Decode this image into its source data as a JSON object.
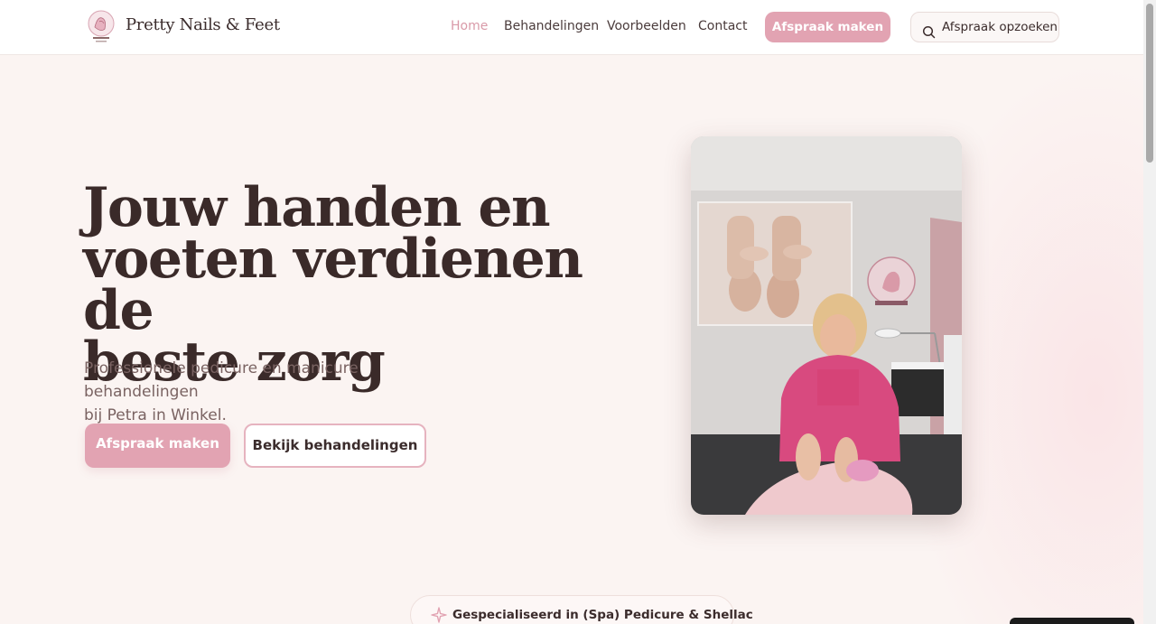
{
  "brand": {
    "name": "Pretty Nails & Feet"
  },
  "nav": {
    "items": [
      {
        "label": "Home",
        "active": true
      },
      {
        "label": "Behandelingen",
        "active": false
      },
      {
        "label": "Voorbeelden",
        "active": false
      },
      {
        "label": "Contact",
        "active": false
      }
    ],
    "cta_label": "Afspraak maken",
    "lookup_label": "Afspraak opzoeken"
  },
  "hero": {
    "title_line1": "Jouw handen en",
    "title_line2": "voeten verdienen de",
    "title_line3": "beste zorg",
    "subtitle_line1": "Professionele pedicure en manicure behandelingen",
    "subtitle_line2": "bij Petra in Winkel.",
    "primary_button": "Afspraak maken",
    "secondary_button": "Bekijk behandelingen"
  },
  "badge": {
    "label": "Gespecialiseerd in (Spa) Pedicure & Shellac"
  },
  "colors": {
    "accent": "#e2a3b2",
    "nav_active": "#d99aa8",
    "background": "#fbf4f2",
    "text": "#3b2c2c"
  },
  "icons": {
    "logo": "nail-salon-logo-icon",
    "lookup": "search-icon",
    "badge": "sparkle-icon"
  }
}
